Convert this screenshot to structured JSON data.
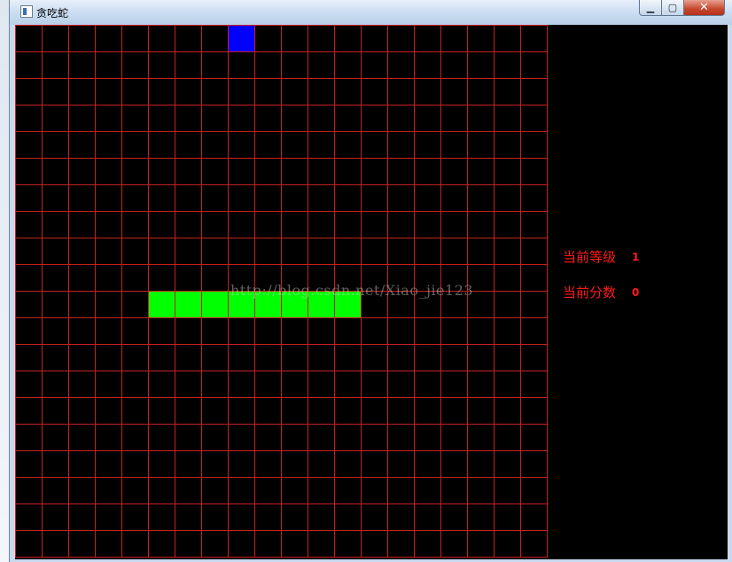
{
  "window": {
    "title": "贪吃蛇",
    "minimize_icon": "minimize-icon",
    "maximize_icon": "maximize-icon",
    "close_icon": "close-icon"
  },
  "board": {
    "columns": 20,
    "rows": 20,
    "grid_color": "#c82020",
    "background": "#000000",
    "food": {
      "col": 8,
      "row": 0,
      "color": "#0000ff"
    },
    "snake": {
      "color": "#00ff00",
      "segments": [
        [
          5,
          10
        ],
        [
          6,
          10
        ],
        [
          7,
          10
        ],
        [
          8,
          10
        ],
        [
          9,
          10
        ],
        [
          10,
          10
        ],
        [
          11,
          10
        ],
        [
          12,
          10
        ]
      ]
    }
  },
  "watermark": "http://blog.csdn.net/Xiao_jie123",
  "stats": {
    "level_label": "当前等级",
    "level_value": "1",
    "score_label": "当前分数",
    "score_value": "0",
    "text_color": "#ff1a1a"
  }
}
